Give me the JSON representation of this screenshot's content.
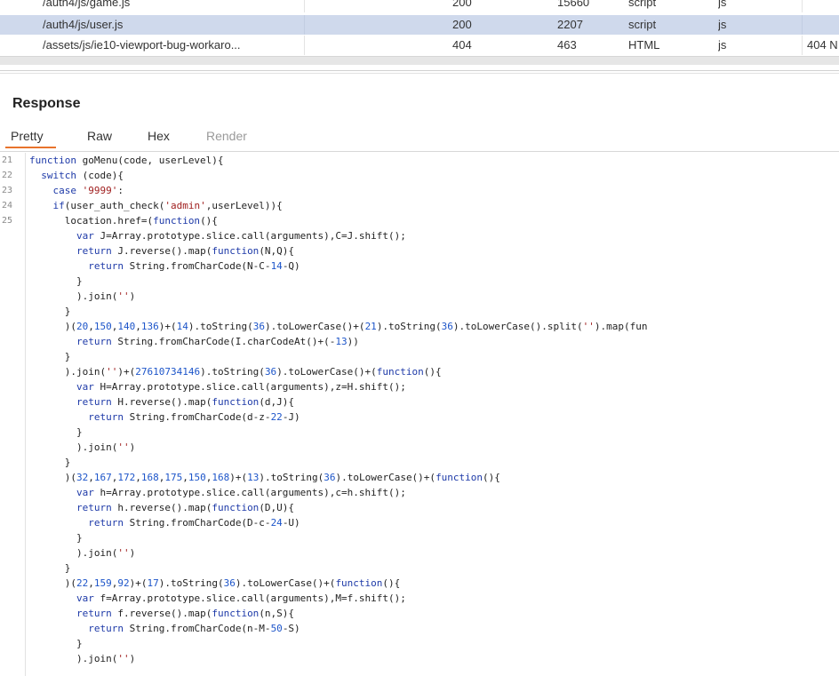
{
  "requests": [
    {
      "path": "/auth4/js/game.js",
      "status": "200",
      "length": "15660",
      "mime": "script",
      "ext": "js",
      "title": "",
      "selected": false
    },
    {
      "path": "/auth4/js/user.js",
      "status": "200",
      "length": "2207",
      "mime": "script",
      "ext": "js",
      "title": "",
      "selected": true
    },
    {
      "path": "/assets/js/ie10-viewport-bug-workaro...",
      "status": "404",
      "length": "463",
      "mime": "HTML",
      "ext": "js",
      "title": "404 N",
      "selected": false
    }
  ],
  "response": {
    "title": "Response",
    "tabs": [
      "Pretty",
      "Raw",
      "Hex",
      "Render"
    ],
    "active_tab": "Pretty"
  },
  "line_numbers": [
    "21",
    "22",
    "23",
    "24",
    "25"
  ],
  "code_lines": [
    "function goMenu(code, userLevel){",
    "  switch (code){",
    "    case '9999':",
    "    if(user_auth_check('admin',userLevel)){",
    "      location.href=(function(){",
    "        var J=Array.prototype.slice.call(arguments),C=J.shift();",
    "        return J.reverse().map(function(N,Q){",
    "          return String.fromCharCode(N-C-14-Q)",
    "        }",
    "        ).join('')",
    "      }",
    "      )(20,150,140,136)+(14).toString(36).toLowerCase()+(21).toString(36).toLowerCase().split('').map(fun",
    "        return String.fromCharCode(I.charCodeAt()+(-13))",
    "      }",
    "      ).join('')+(27610734146).toString(36).toLowerCase()+(function(){",
    "        var H=Array.prototype.slice.call(arguments),z=H.shift();",
    "        return H.reverse().map(function(d,J){",
    "          return String.fromCharCode(d-z-22-J)",
    "        }",
    "        ).join('')",
    "      }",
    "      )(32,167,172,168,175,150,168)+(13).toString(36).toLowerCase()+(function(){",
    "        var h=Array.prototype.slice.call(arguments),c=h.shift();",
    "        return h.reverse().map(function(D,U){",
    "          return String.fromCharCode(D-c-24-U)",
    "        }",
    "        ).join('')",
    "      }",
    "      )(22,159,92)+(17).toString(36).toLowerCase()+(function(){",
    "        var f=Array.prototype.slice.call(arguments),M=f.shift();",
    "        return f.reverse().map(function(n,S){",
    "          return String.fromCharCode(n-M-50-S)",
    "        }",
    "        ).join('')"
  ],
  "colors": {
    "selected_row": "#cfd9ec",
    "active_tab_underline": "#e8732c",
    "keyword": "#1e3aa8",
    "string": "#a02020",
    "number": "#1d55c9"
  }
}
